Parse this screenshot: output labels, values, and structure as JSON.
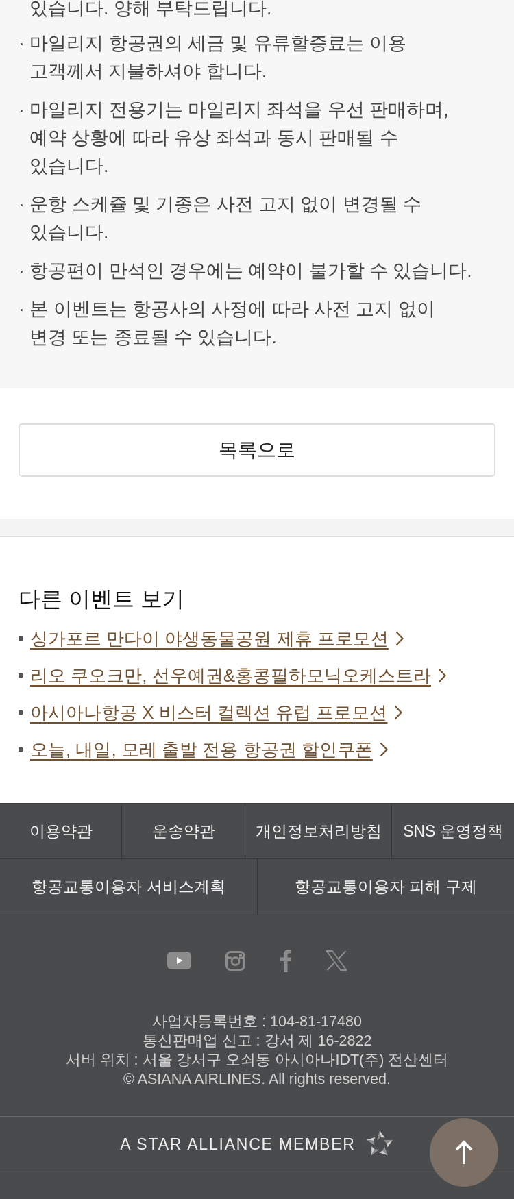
{
  "notice": {
    "continued_line": "있습니다. 양해 부탁드립니다.",
    "items": [
      {
        "lines": [
          "· 마일리지 항공권의 세금 및 유류할증료는 이용",
          "고객께서 지불하셔야 합니다."
        ]
      },
      {
        "lines": [
          "· 마일리지 전용기는 마일리지 좌석을 우선 판매하며,",
          "예약 상황에 따라 유상 좌석과 동시 판매될 수",
          "있습니다."
        ]
      },
      {
        "lines": [
          "· 운항 스케쥴 및 기종은 사전 고지 없이 변경될 수",
          "있습니다."
        ]
      },
      {
        "lines": [
          "· 항공편이 만석인 경우에는 예약이 불가할 수 있습니다."
        ]
      },
      {
        "lines": [
          "· 본 이벤트는 항공사의 사정에 따라 사전 고지 없이",
          "변경 또는 종료될 수 있습니다."
        ]
      }
    ]
  },
  "list_button": {
    "label": "목록으로"
  },
  "other_events": {
    "title": "다른 이벤트 보기",
    "links": [
      {
        "label": "싱가포르 만다이 야생동물공원 제휴 프로모션"
      },
      {
        "label": "리오 쿠오크만, 선우예권&홍콩필하모닉오케스트라"
      },
      {
        "label": "아시아나항공 X 비스터 컬렉션 유럽 프로모션"
      },
      {
        "label": "오늘, 내일, 모레 출발 전용 항공권 할인쿠폰"
      }
    ]
  },
  "footer": {
    "nav_rows": [
      [
        {
          "label": "이용약관"
        },
        {
          "label": "운송약관"
        },
        {
          "label": "개인정보처리방침"
        },
        {
          "label": "SNS 운영정책"
        }
      ],
      [
        {
          "label": "항공교통이용자 서비스계획"
        },
        {
          "label": "항공교통이용자 피해 구제"
        }
      ]
    ],
    "company_info": [
      "사업자등록번호 : 104-81-17480",
      "통신판매업 신고 : 강서 제 16-2822",
      "서버 위치 : 서울 강서구 오쇠동 아시아나IDT(주) 전산센터",
      "© ASIANA AIRLINES. All rights reserved."
    ],
    "alliance_label": "A STAR ALLIANCE MEMBER"
  }
}
